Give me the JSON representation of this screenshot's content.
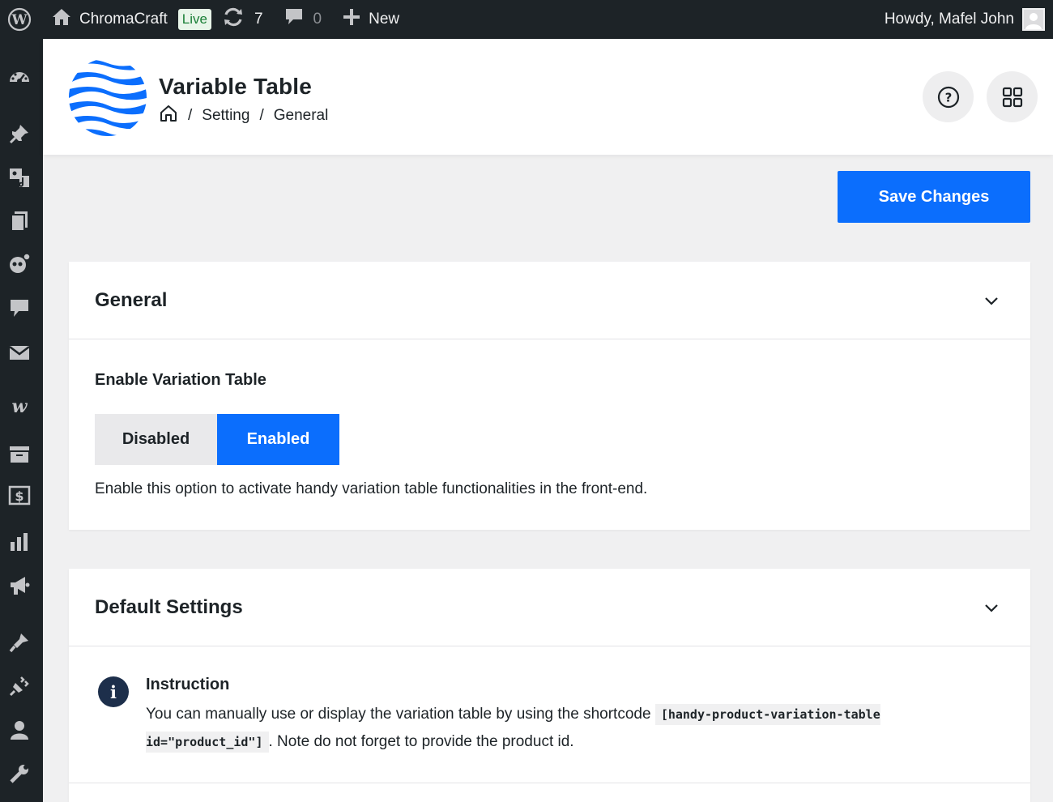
{
  "admin_bar": {
    "site_name": "ChromaCraft",
    "live_badge": "Live",
    "updates_count": "7",
    "comments_count": "0",
    "new_label": "New",
    "greeting": "Howdy, Mafel John"
  },
  "sidebar": {
    "icons": [
      "dashboard-icon",
      "pin-icon",
      "media-icon",
      "pages-icon",
      "plugin-custom-icon",
      "comments-icon",
      "mail-icon",
      "woo-icon",
      "archive-icon",
      "payments-icon",
      "analytics-icon",
      "marketing-icon",
      "appearance-icon",
      "plugins-icon",
      "users-icon",
      "tools-icon"
    ]
  },
  "header": {
    "title": "Variable Table",
    "breadcrumb": {
      "sep": "/",
      "item1": "Setting",
      "item2": "General"
    }
  },
  "toolbar": {
    "save_label": "Save Changes"
  },
  "general": {
    "title": "General",
    "field_label": "Enable Variation Table",
    "option_disabled": "Disabled",
    "option_enabled": "Enabled",
    "selected": "Enabled",
    "description": "Enable this option to activate handy variation table functionalities in the front-end."
  },
  "defaults": {
    "title": "Default Settings",
    "instruction_title": "Instruction",
    "instruction_text_before": "You can manually use or display the variation table by using the shortcode",
    "shortcode": "[handy-product-variation-table id=\"product_id\"]",
    "instruction_text_after": ". Note do not forget to provide the product id."
  },
  "colors": {
    "accent": "#0b6efd",
    "admin_bg": "#1d2327",
    "live_badge_text": "#1a7f37"
  }
}
